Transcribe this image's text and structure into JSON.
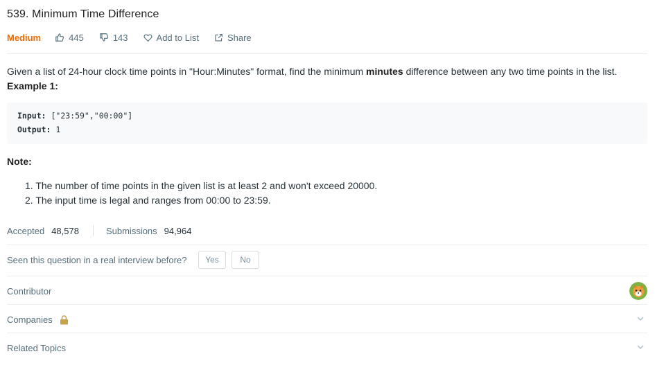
{
  "problem": {
    "title": "539. Minimum Time Difference",
    "difficulty": "Medium",
    "likes": "445",
    "dislikes": "143",
    "add_to_list_label": "Add to List",
    "share_label": "Share"
  },
  "description": {
    "text_before": "Given a list of 24-hour clock time points in \"Hour:Minutes\" format, find the minimum ",
    "text_bold": "minutes",
    "text_after": " difference between any two time points in the list.",
    "example_title": "Example 1:",
    "input_label": "Input:",
    "input_value": " [\"23:59\",\"00:00\"]",
    "output_label": "Output:",
    "output_value": " 1",
    "note_title": "Note:",
    "notes": [
      "1. The number of time points in the given list is at least 2 and won't exceed 20000.",
      "2. The input time is legal and ranges from 00:00 to 23:59."
    ]
  },
  "stats": {
    "accepted_label": "Accepted",
    "accepted_value": "48,578",
    "submissions_label": "Submissions",
    "submissions_value": "94,964"
  },
  "interview": {
    "question": "Seen this question in a real interview before?",
    "yes_label": "Yes",
    "no_label": "No"
  },
  "sections": {
    "contributor": "Contributor",
    "companies": "Companies",
    "related_topics": "Related Topics"
  },
  "colors": {
    "difficulty_medium": "#ef6c00",
    "lock": "#c8a24a"
  },
  "icons": [
    "thumbs-up-icon",
    "thumbs-down-icon",
    "heart-icon",
    "share-icon",
    "lock-icon",
    "chevron-down-icon",
    "avatar"
  ]
}
